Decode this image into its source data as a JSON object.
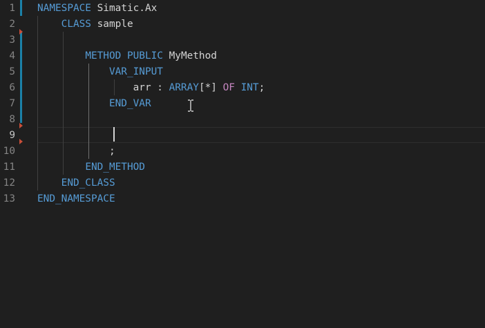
{
  "editor": {
    "lines": [
      {
        "number": "1",
        "tokens": [
          {
            "t": "NAMESPACE",
            "c": "kw"
          },
          {
            "t": " Simatic.Ax",
            "c": "plain"
          }
        ]
      },
      {
        "number": "2",
        "tokens": [
          {
            "t": "    ",
            "c": "plain"
          },
          {
            "t": "CLASS",
            "c": "kw"
          },
          {
            "t": " sample",
            "c": "plain"
          }
        ]
      },
      {
        "number": "3",
        "tokens": []
      },
      {
        "number": "4",
        "tokens": [
          {
            "t": "        ",
            "c": "plain"
          },
          {
            "t": "METHOD",
            "c": "kw"
          },
          {
            "t": " ",
            "c": "plain"
          },
          {
            "t": "PUBLIC",
            "c": "kw"
          },
          {
            "t": " MyMethod",
            "c": "plain"
          }
        ]
      },
      {
        "number": "5",
        "tokens": [
          {
            "t": "            ",
            "c": "plain"
          },
          {
            "t": "VAR_INPUT",
            "c": "kw"
          }
        ]
      },
      {
        "number": "6",
        "tokens": [
          {
            "t": "                arr : ",
            "c": "plain"
          },
          {
            "t": "ARRAY",
            "c": "kw"
          },
          {
            "t": "[*] ",
            "c": "plain"
          },
          {
            "t": "OF",
            "c": "ctl"
          },
          {
            "t": " ",
            "c": "plain"
          },
          {
            "t": "INT",
            "c": "kw"
          },
          {
            "t": ";",
            "c": "plain"
          }
        ]
      },
      {
        "number": "7",
        "tokens": [
          {
            "t": "            ",
            "c": "plain"
          },
          {
            "t": "END_VAR",
            "c": "kw"
          }
        ]
      },
      {
        "number": "8",
        "tokens": []
      },
      {
        "number": "9",
        "tokens": []
      },
      {
        "number": "10",
        "tokens": [
          {
            "t": "            ;",
            "c": "plain"
          }
        ]
      },
      {
        "number": "11",
        "tokens": [
          {
            "t": "        ",
            "c": "plain"
          },
          {
            "t": "END_METHOD",
            "c": "kw"
          }
        ]
      },
      {
        "number": "12",
        "tokens": [
          {
            "t": "    ",
            "c": "plain"
          },
          {
            "t": "END_CLASS",
            "c": "kw"
          }
        ]
      },
      {
        "number": "13",
        "tokens": [
          {
            "t": "END_NAMESPACE",
            "c": "kw"
          }
        ]
      }
    ],
    "active_line": "9",
    "colors": {
      "background": "#1f1f1f",
      "keyword": "#569cd6",
      "control_keyword": "#c586c0",
      "text": "#d4d4d4",
      "line_number": "#858585",
      "modified_bar": "#1b81a8",
      "deleted_marker": "#c74e39"
    }
  }
}
